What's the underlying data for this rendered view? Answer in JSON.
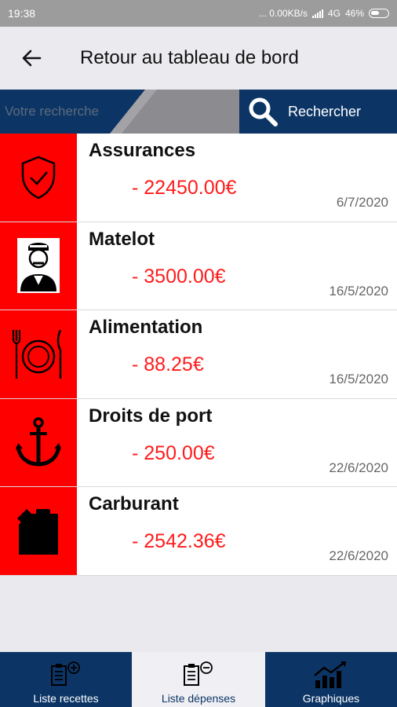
{
  "status": {
    "time": "19:38",
    "net": "... 0.00KB/s",
    "network": "4G",
    "battery": "46%"
  },
  "header": {
    "title": "Retour au tableau de bord"
  },
  "search": {
    "placeholder": "Votre recherche",
    "button_label": "Rechercher"
  },
  "expenses": [
    {
      "name": "Assurances",
      "amount": "- 22450.00€",
      "date": "6/7/2020",
      "icon": "shield-check-icon"
    },
    {
      "name": "Matelot",
      "amount": "- 3500.00€",
      "date": "16/5/2020",
      "icon": "sailor-icon"
    },
    {
      "name": "Alimentation",
      "amount": "- 88.25€",
      "date": "16/5/2020",
      "icon": "plate-cutlery-icon"
    },
    {
      "name": "Droits de port",
      "amount": "- 250.00€",
      "date": "22/6/2020",
      "icon": "anchor-icon"
    },
    {
      "name": "Carburant",
      "amount": "- 2542.36€",
      "date": "22/6/2020",
      "icon": "fuel-can-icon"
    }
  ],
  "tabs": [
    {
      "label": "Liste recettes",
      "icon": "clipboard-plus-icon"
    },
    {
      "label": "Liste dépenses",
      "icon": "clipboard-minus-icon"
    },
    {
      "label": "Graphiques",
      "icon": "chart-icon"
    }
  ],
  "colors": {
    "accent": "#0c3566",
    "expense_red": "#ff0000",
    "amount_red": "#ff1b1b"
  }
}
